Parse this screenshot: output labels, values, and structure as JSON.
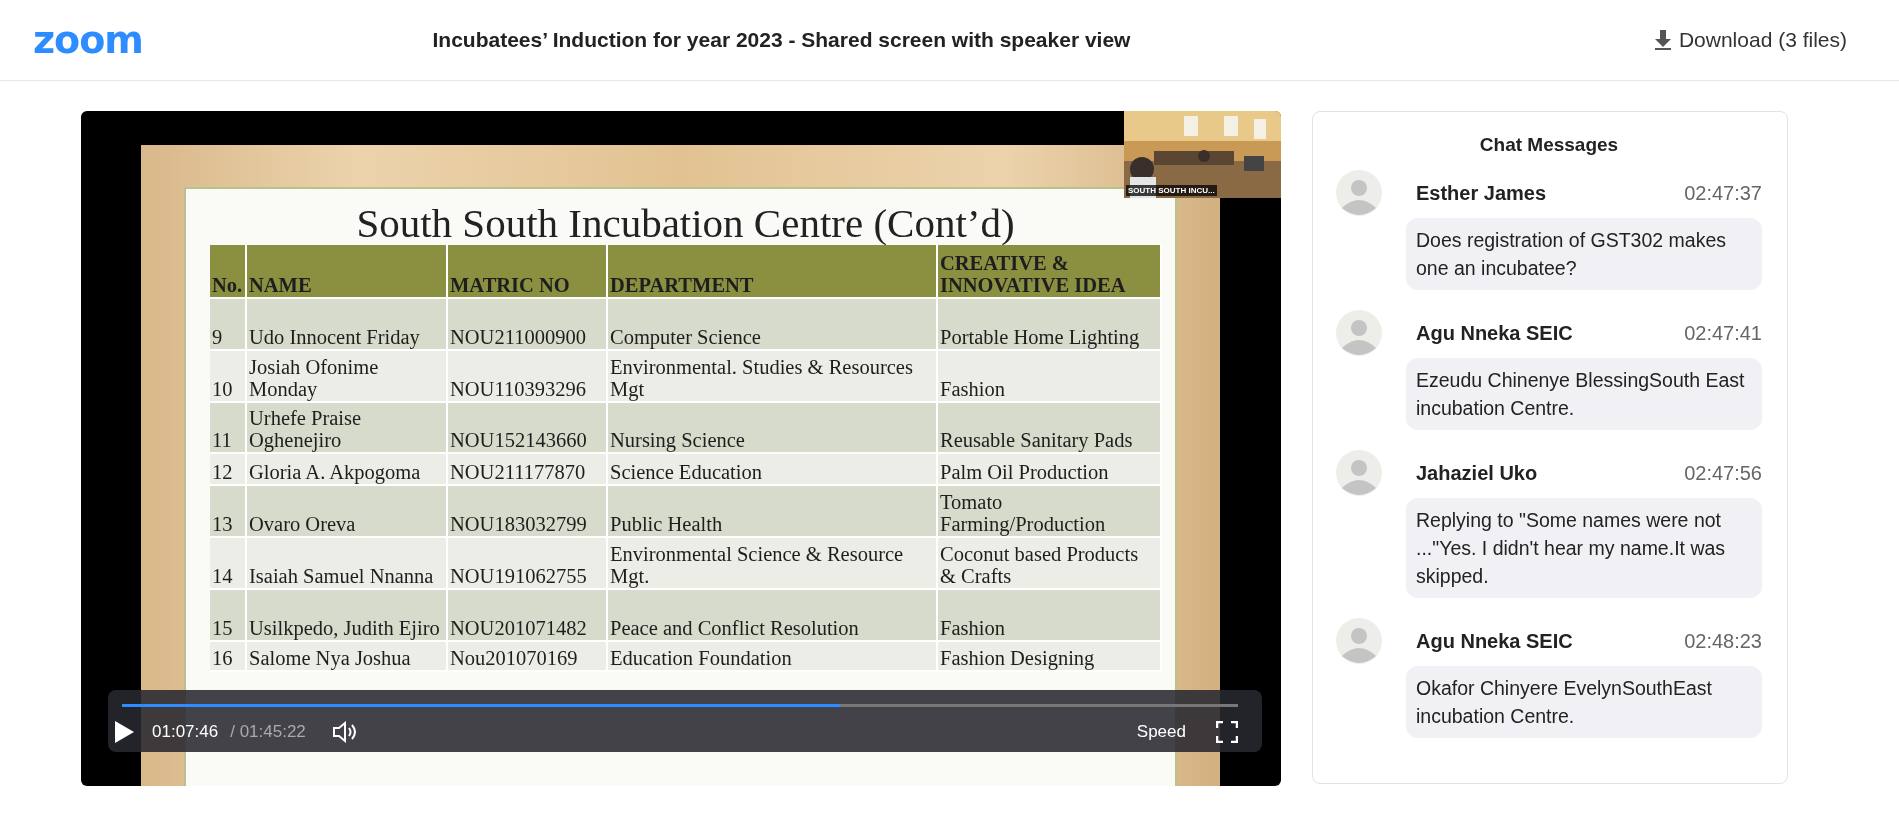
{
  "header": {
    "logo": "zoom",
    "title": "Incubatees’ Induction for year 2023 - Shared screen with speaker view",
    "download": "Download (3 files)"
  },
  "video": {
    "speaker_label": "SOUTH SOUTH INCU...",
    "slide": {
      "title": "South South Incubation Centre (Cont’d)",
      "columns": [
        "No.",
        "NAME",
        "MATRIC NO",
        "DEPARTMENT",
        "CREATIVE & INNOVATIVE IDEA"
      ],
      "rows": [
        [
          "9",
          "Udo Innocent Friday",
          "NOU211000900",
          "Computer Science",
          "Portable Home Lighting"
        ],
        [
          "10",
          "Josiah Ofonime Monday",
          "NOU110393296",
          "Environmental. Studies & Resources Mgt",
          "Fashion"
        ],
        [
          "11",
          "Urhefe Praise Oghenejiro",
          "NOU152143660",
          "Nursing Science",
          "Reusable Sanitary Pads"
        ],
        [
          "12",
          "Gloria A. Akpogoma",
          "NOU211177870",
          "Science Education",
          "Palm Oil Production"
        ],
        [
          "13",
          "Ovaro Oreva",
          "NOU183032799",
          "Public Health",
          "Tomato Farming/Production"
        ],
        [
          "14",
          "Isaiah Samuel Nnanna",
          "NOU191062755",
          "Environmental Science & Resource Mgt.",
          "Coconut based Products & Crafts"
        ],
        [
          "15",
          "Usilkpedo, Judith Ejiro",
          "NOU201071482",
          "Peace and Conflict Resolution",
          "Fashion"
        ],
        [
          "16",
          "Salome Nya Joshua",
          "Nou201070169",
          "Education Foundation",
          "Fashion Designing"
        ]
      ]
    },
    "controls": {
      "playing": false,
      "level": 0.643,
      "current_time": "01:07:46",
      "total_time": "/ 01:45:22",
      "speed": "Speed"
    }
  },
  "chat": {
    "title": "Chat Messages",
    "messages": [
      {
        "sender": "Esther James",
        "time": "02:47:37",
        "text": "Does registration of GST302 makes one an incubatee?"
      },
      {
        "sender": "Agu Nneka SEIC",
        "time": "02:47:41",
        "text": "Ezeudu Chinenye BlessingSouth East incubation Centre."
      },
      {
        "sender": "Jahaziel Uko",
        "time": "02:47:56",
        "text": "Replying to \"Some names were not ...\"Yes. I didn't hear my name.It was skipped."
      },
      {
        "sender": "Agu Nneka SEIC",
        "time": "02:48:23",
        "text": "Okafor Chinyere EvelynSouthEast incubation Centre."
      }
    ]
  }
}
